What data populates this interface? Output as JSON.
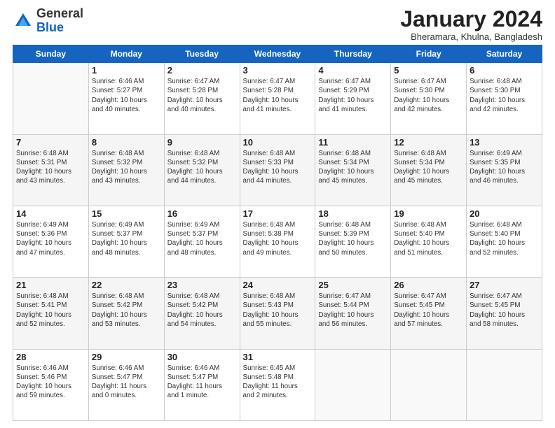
{
  "header": {
    "logo_line1": "General",
    "logo_line2": "Blue",
    "month_title": "January 2024",
    "location": "Bheramara, Khulna, Bangladesh"
  },
  "days_of_week": [
    "Sunday",
    "Monday",
    "Tuesday",
    "Wednesday",
    "Thursday",
    "Friday",
    "Saturday"
  ],
  "weeks": [
    [
      {
        "day": "",
        "info": ""
      },
      {
        "day": "1",
        "info": "Sunrise: 6:46 AM\nSunset: 5:27 PM\nDaylight: 10 hours\nand 40 minutes."
      },
      {
        "day": "2",
        "info": "Sunrise: 6:47 AM\nSunset: 5:28 PM\nDaylight: 10 hours\nand 40 minutes."
      },
      {
        "day": "3",
        "info": "Sunrise: 6:47 AM\nSunset: 5:28 PM\nDaylight: 10 hours\nand 41 minutes."
      },
      {
        "day": "4",
        "info": "Sunrise: 6:47 AM\nSunset: 5:29 PM\nDaylight: 10 hours\nand 41 minutes."
      },
      {
        "day": "5",
        "info": "Sunrise: 6:47 AM\nSunset: 5:30 PM\nDaylight: 10 hours\nand 42 minutes."
      },
      {
        "day": "6",
        "info": "Sunrise: 6:48 AM\nSunset: 5:30 PM\nDaylight: 10 hours\nand 42 minutes."
      }
    ],
    [
      {
        "day": "7",
        "info": "Sunrise: 6:48 AM\nSunset: 5:31 PM\nDaylight: 10 hours\nand 43 minutes."
      },
      {
        "day": "8",
        "info": "Sunrise: 6:48 AM\nSunset: 5:32 PM\nDaylight: 10 hours\nand 43 minutes."
      },
      {
        "day": "9",
        "info": "Sunrise: 6:48 AM\nSunset: 5:32 PM\nDaylight: 10 hours\nand 44 minutes."
      },
      {
        "day": "10",
        "info": "Sunrise: 6:48 AM\nSunset: 5:33 PM\nDaylight: 10 hours\nand 44 minutes."
      },
      {
        "day": "11",
        "info": "Sunrise: 6:48 AM\nSunset: 5:34 PM\nDaylight: 10 hours\nand 45 minutes."
      },
      {
        "day": "12",
        "info": "Sunrise: 6:48 AM\nSunset: 5:34 PM\nDaylight: 10 hours\nand 45 minutes."
      },
      {
        "day": "13",
        "info": "Sunrise: 6:49 AM\nSunset: 5:35 PM\nDaylight: 10 hours\nand 46 minutes."
      }
    ],
    [
      {
        "day": "14",
        "info": "Sunrise: 6:49 AM\nSunset: 5:36 PM\nDaylight: 10 hours\nand 47 minutes."
      },
      {
        "day": "15",
        "info": "Sunrise: 6:49 AM\nSunset: 5:37 PM\nDaylight: 10 hours\nand 48 minutes."
      },
      {
        "day": "16",
        "info": "Sunrise: 6:49 AM\nSunset: 5:37 PM\nDaylight: 10 hours\nand 48 minutes."
      },
      {
        "day": "17",
        "info": "Sunrise: 6:48 AM\nSunset: 5:38 PM\nDaylight: 10 hours\nand 49 minutes."
      },
      {
        "day": "18",
        "info": "Sunrise: 6:48 AM\nSunset: 5:39 PM\nDaylight: 10 hours\nand 50 minutes."
      },
      {
        "day": "19",
        "info": "Sunrise: 6:48 AM\nSunset: 5:40 PM\nDaylight: 10 hours\nand 51 minutes."
      },
      {
        "day": "20",
        "info": "Sunrise: 6:48 AM\nSunset: 5:40 PM\nDaylight: 10 hours\nand 52 minutes."
      }
    ],
    [
      {
        "day": "21",
        "info": "Sunrise: 6:48 AM\nSunset: 5:41 PM\nDaylight: 10 hours\nand 52 minutes."
      },
      {
        "day": "22",
        "info": "Sunrise: 6:48 AM\nSunset: 5:42 PM\nDaylight: 10 hours\nand 53 minutes."
      },
      {
        "day": "23",
        "info": "Sunrise: 6:48 AM\nSunset: 5:42 PM\nDaylight: 10 hours\nand 54 minutes."
      },
      {
        "day": "24",
        "info": "Sunrise: 6:48 AM\nSunset: 5:43 PM\nDaylight: 10 hours\nand 55 minutes."
      },
      {
        "day": "25",
        "info": "Sunrise: 6:47 AM\nSunset: 5:44 PM\nDaylight: 10 hours\nand 56 minutes."
      },
      {
        "day": "26",
        "info": "Sunrise: 6:47 AM\nSunset: 5:45 PM\nDaylight: 10 hours\nand 57 minutes."
      },
      {
        "day": "27",
        "info": "Sunrise: 6:47 AM\nSunset: 5:45 PM\nDaylight: 10 hours\nand 58 minutes."
      }
    ],
    [
      {
        "day": "28",
        "info": "Sunrise: 6:46 AM\nSunset: 5:46 PM\nDaylight: 10 hours\nand 59 minutes."
      },
      {
        "day": "29",
        "info": "Sunrise: 6:46 AM\nSunset: 5:47 PM\nDaylight: 11 hours\nand 0 minutes."
      },
      {
        "day": "30",
        "info": "Sunrise: 6:46 AM\nSunset: 5:47 PM\nDaylight: 11 hours\nand 1 minute."
      },
      {
        "day": "31",
        "info": "Sunrise: 6:45 AM\nSunset: 5:48 PM\nDaylight: 11 hours\nand 2 minutes."
      },
      {
        "day": "",
        "info": ""
      },
      {
        "day": "",
        "info": ""
      },
      {
        "day": "",
        "info": ""
      }
    ]
  ]
}
